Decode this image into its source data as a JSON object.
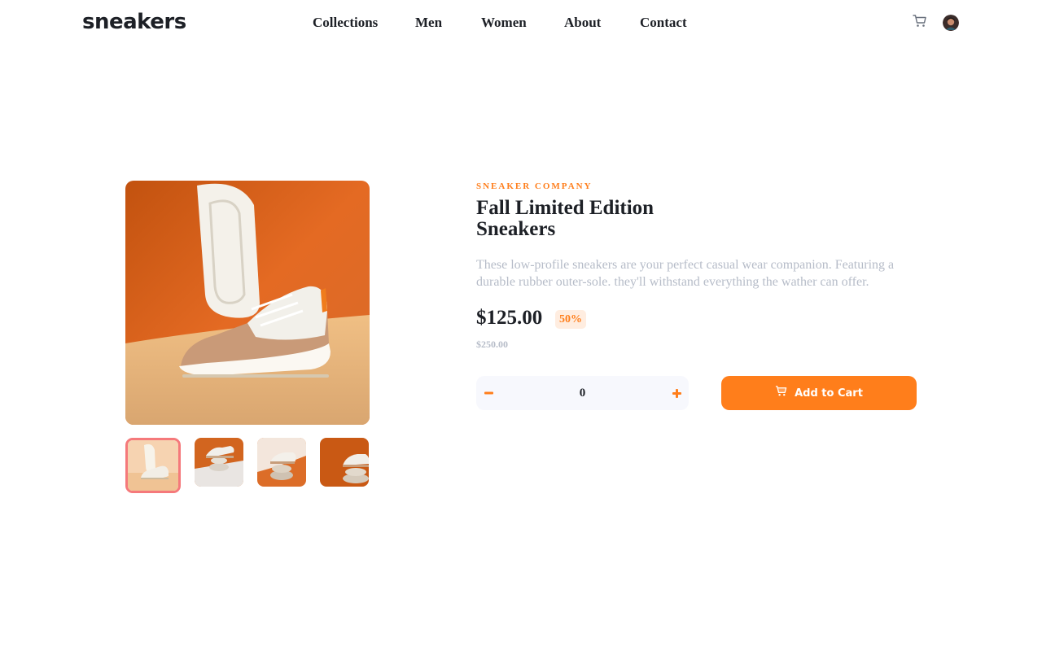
{
  "header": {
    "logo": "sneakers",
    "nav": [
      {
        "label": "Collections"
      },
      {
        "label": "Men"
      },
      {
        "label": "Women"
      },
      {
        "label": "About"
      },
      {
        "label": "Contact"
      }
    ],
    "cart_icon": "cart-icon",
    "avatar_icon": "user-avatar"
  },
  "gallery": {
    "main_image": "white-and-tan-sneakers-on-orange-background",
    "thumbnails": [
      {
        "image": "sneaker-pair-thumbnail",
        "active": true
      },
      {
        "image": "sneakers-on-stones-thumbnail",
        "active": false
      },
      {
        "image": "sneaker-on-stone-orange-thumbnail",
        "active": false
      },
      {
        "image": "sneaker-balanced-stones-thumbnail",
        "active": false
      }
    ]
  },
  "product": {
    "company": "SNEAKER COMPANY",
    "title": "Fall Limited Edition Sneakers",
    "description": "These low-profile sneakers are your perfect casual wear companion. Featuring a durable rubber outer-sole. they'll withstand everything the wather can offer.",
    "price": "$125.00",
    "discount": "50%",
    "original_price": "$250.00"
  },
  "quantity": {
    "value": "0",
    "minus_icon": "minus-icon",
    "plus_icon": "plus-icon"
  },
  "add_to_cart": {
    "label": "Add to Cart",
    "icon": "cart-icon"
  },
  "colors": {
    "accent": "#ff7e1b",
    "accent_pale": "#ffede0",
    "dark": "#1d2026",
    "muted": "#b6bcc8",
    "light_bg": "#f7f8fd",
    "active_thumb_border": "#f5797b"
  }
}
